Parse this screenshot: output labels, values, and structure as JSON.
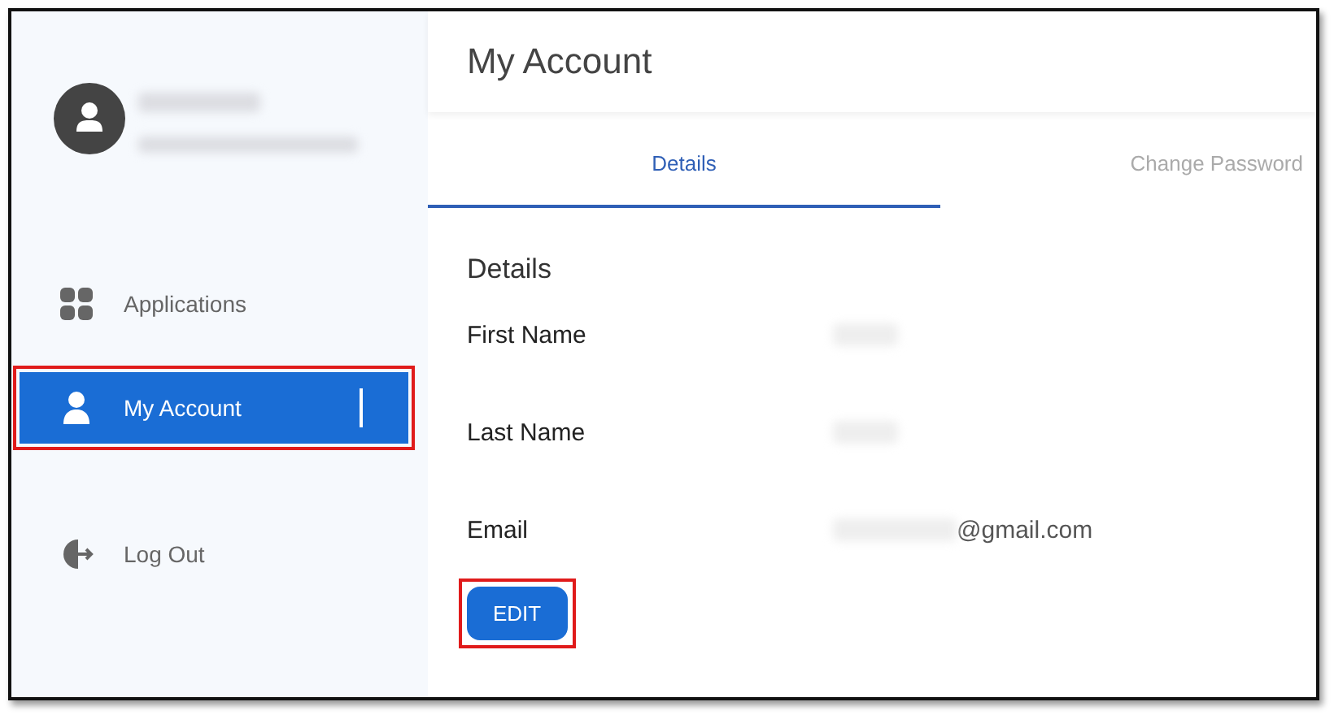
{
  "user": {
    "redacted": true
  },
  "nav": [
    {
      "label": "Applications",
      "kind": "apps",
      "selected": false,
      "highlighted": false
    },
    {
      "label": "My Account",
      "kind": "user",
      "selected": true,
      "highlighted": true
    },
    {
      "label": "Log Out",
      "kind": "logout",
      "selected": false,
      "highlighted": false
    }
  ],
  "page_title": "My Account",
  "tabs": [
    {
      "label": "Details",
      "selected": true
    },
    {
      "label": "Change Password",
      "selected": false
    }
  ],
  "section_title": "Details",
  "fields": [
    {
      "label": "First Name",
      "redacted": true
    },
    {
      "label": "Last Name",
      "redacted": true
    },
    {
      "label": "Email",
      "redacted": true,
      "value": "@gmail.com"
    }
  ],
  "edit_button": {
    "label": "EDIT",
    "highlighted": true
  }
}
